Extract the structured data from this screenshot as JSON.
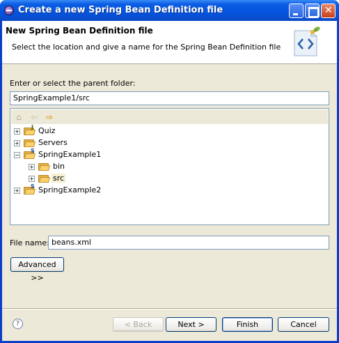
{
  "window": {
    "title": "Create a new Spring Bean Definition file"
  },
  "banner": {
    "title": "New Spring Bean Definition file",
    "description": "Select the location and give a name for the Spring Bean Definition file"
  },
  "parent_folder": {
    "label": "Enter or select the parent folder:",
    "value": "SpringExample1/src"
  },
  "tree": {
    "toolbar": {
      "home_icon": "home-icon",
      "back_icon": "back-arrow-icon",
      "forward_icon": "forward-arrow-icon"
    },
    "items": [
      {
        "label": "Quiz",
        "expander": "+"
      },
      {
        "label": "Servers",
        "expander": "+"
      },
      {
        "label": "SpringExample1",
        "expander": "−"
      },
      {
        "label": "bin",
        "expander": "+"
      },
      {
        "label": "src",
        "expander": "+"
      },
      {
        "label": "SpringExample2",
        "expander": "+"
      }
    ]
  },
  "file_name": {
    "label": "File name:",
    "value": "beans.xml"
  },
  "buttons": {
    "advanced": "Advanced >>",
    "back": "< Back",
    "next": "Next >",
    "finish": "Finish",
    "cancel": "Cancel",
    "help": "?"
  }
}
